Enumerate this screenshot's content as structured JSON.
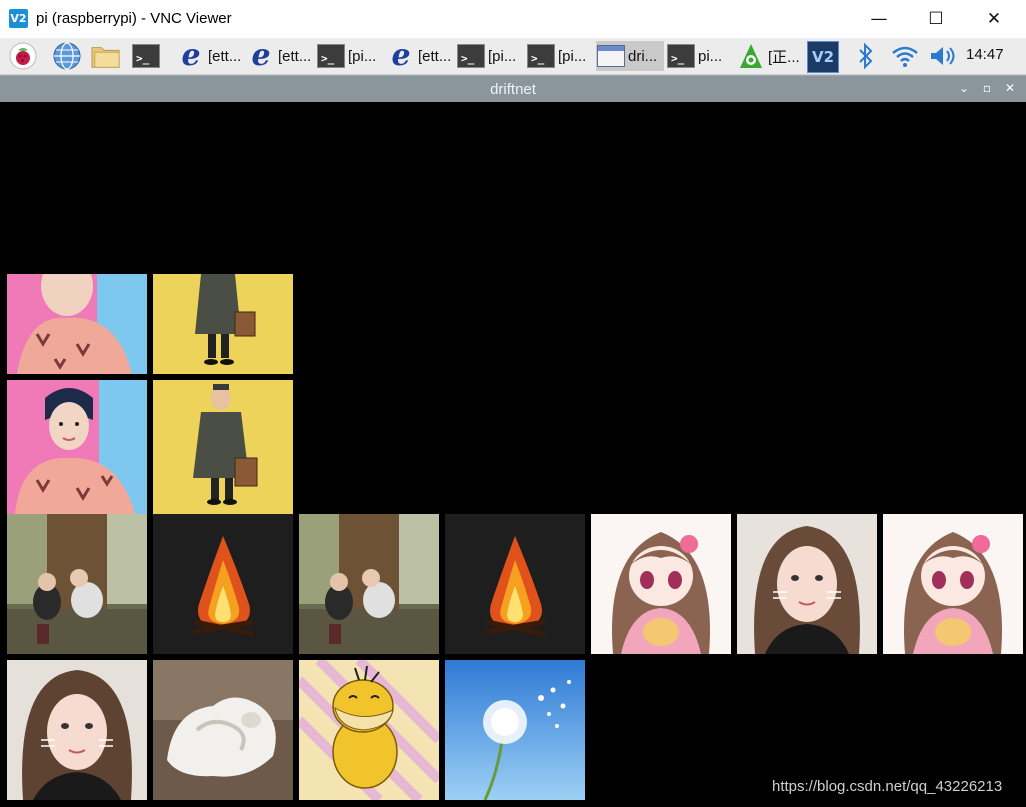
{
  "window": {
    "title": "pi (raspberrypi) - VNC Viewer",
    "app_icon_text": "V2",
    "minimize_glyph": "—",
    "maximize_glyph": "☐",
    "close_glyph": "✕"
  },
  "taskbar": {
    "launchers": [
      "raspberry-menu-icon",
      "web-browser-icon",
      "file-manager-icon",
      "terminal-icon"
    ],
    "tasks": [
      {
        "label": "[ett...",
        "icon": "e-editor-icon"
      },
      {
        "label": "[ett...",
        "icon": "e-editor-icon"
      },
      {
        "label": "[pi...",
        "icon": "terminal-icon"
      },
      {
        "label": "[ett...",
        "icon": "e-editor-icon"
      },
      {
        "label": "[pi...",
        "icon": "terminal-icon"
      },
      {
        "label": "[pi...",
        "icon": "terminal-icon"
      },
      {
        "label": "dri...",
        "icon": "window-icon"
      },
      {
        "label": "pi...",
        "icon": "terminal-icon"
      },
      {
        "label": "[正...",
        "icon": "package-icon"
      }
    ],
    "tray": [
      "vnc-server-icon",
      "bluetooth-icon",
      "wifi-icon",
      "volume-icon"
    ],
    "clock": "14:47"
  },
  "driftnet": {
    "title": "driftnet",
    "menu_glyph": "⌄",
    "max_glyph": "▫",
    "close_glyph": "✕"
  },
  "captured_images": [
    "pink-shirt-portrait",
    "man-in-coat-yellow-bg",
    "pink-shirt-portrait",
    "man-in-coat-yellow-bg",
    "two-children-by-tree",
    "campfire",
    "two-children-by-tree",
    "campfire",
    "anime-girl-pink-kimono",
    "girl-selfie-whiskers",
    "anime-girl-pink-kimono",
    "girl-selfie-whiskers",
    "white-jade-carving",
    "psyduck",
    "dandelion-blue-sky"
  ],
  "watermark": "https://blog.csdn.net/qq_43226213"
}
